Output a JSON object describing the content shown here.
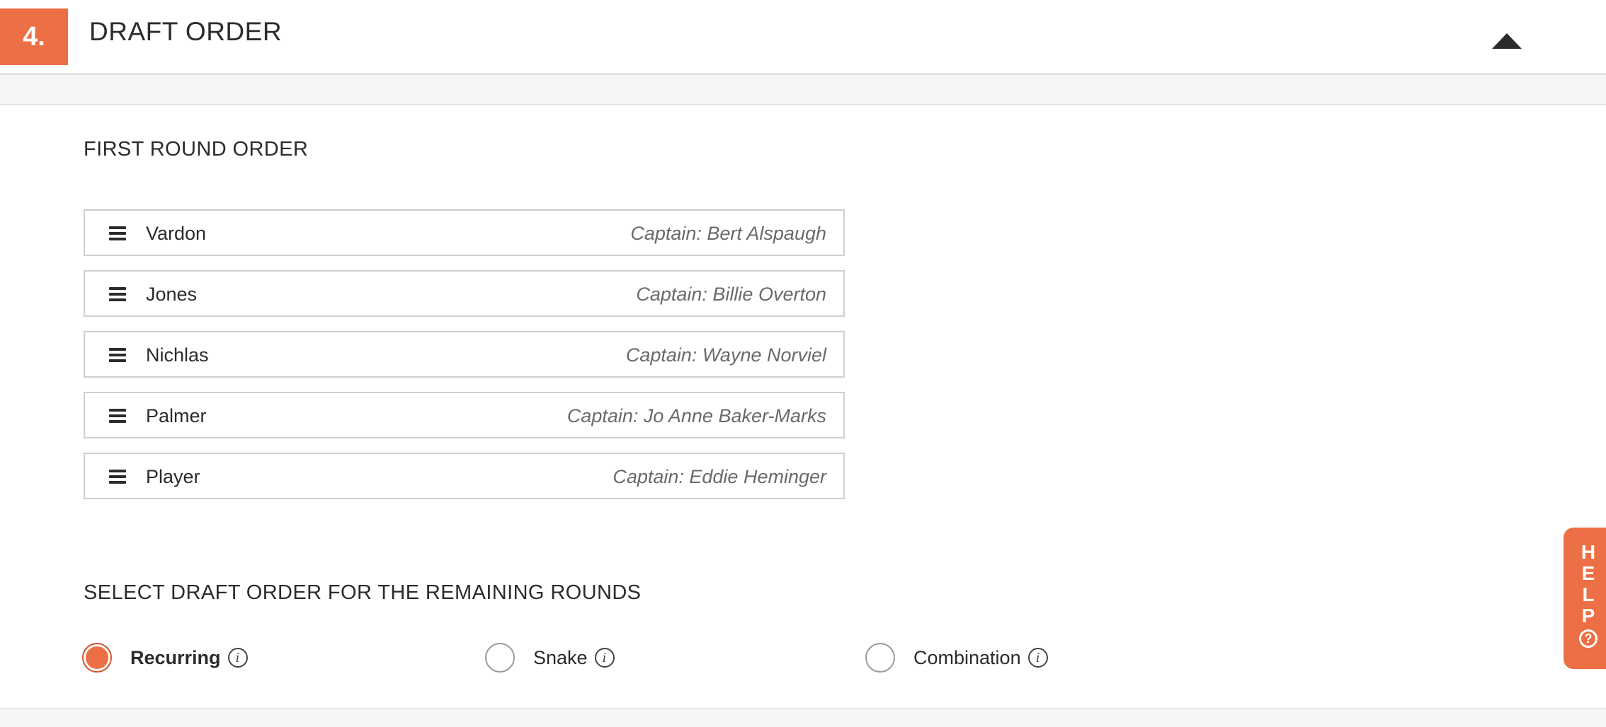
{
  "header": {
    "step_number": "4.",
    "title": "DRAFT ORDER",
    "collapse_icon": "caret-up-icon"
  },
  "first_round": {
    "heading": "FIRST ROUND ORDER",
    "teams": [
      {
        "name": "Vardon",
        "captain": "Captain: Bert Alspaugh"
      },
      {
        "name": "Jones",
        "captain": "Captain: Billie Overton"
      },
      {
        "name": "Nichlas",
        "captain": "Captain: Wayne Norviel"
      },
      {
        "name": "Palmer",
        "captain": "Captain: Jo Anne Baker-Marks"
      },
      {
        "name": "Player",
        "captain": "Captain: Eddie Heminger"
      }
    ]
  },
  "remaining_rounds": {
    "heading": "SELECT DRAFT ORDER FOR THE REMAINING ROUNDS",
    "options": [
      {
        "label": "Recurring",
        "selected": true
      },
      {
        "label": "Snake",
        "selected": false
      },
      {
        "label": "Combination",
        "selected": false
      }
    ],
    "info_glyph": "i"
  },
  "help": {
    "letters": [
      "H",
      "E",
      "L",
      "P"
    ],
    "question_glyph": "?"
  },
  "colors": {
    "accent": "#ec6f45",
    "text": "#2b2b2b",
    "muted": "#6a6a6a",
    "border": "#cfcfcf"
  }
}
